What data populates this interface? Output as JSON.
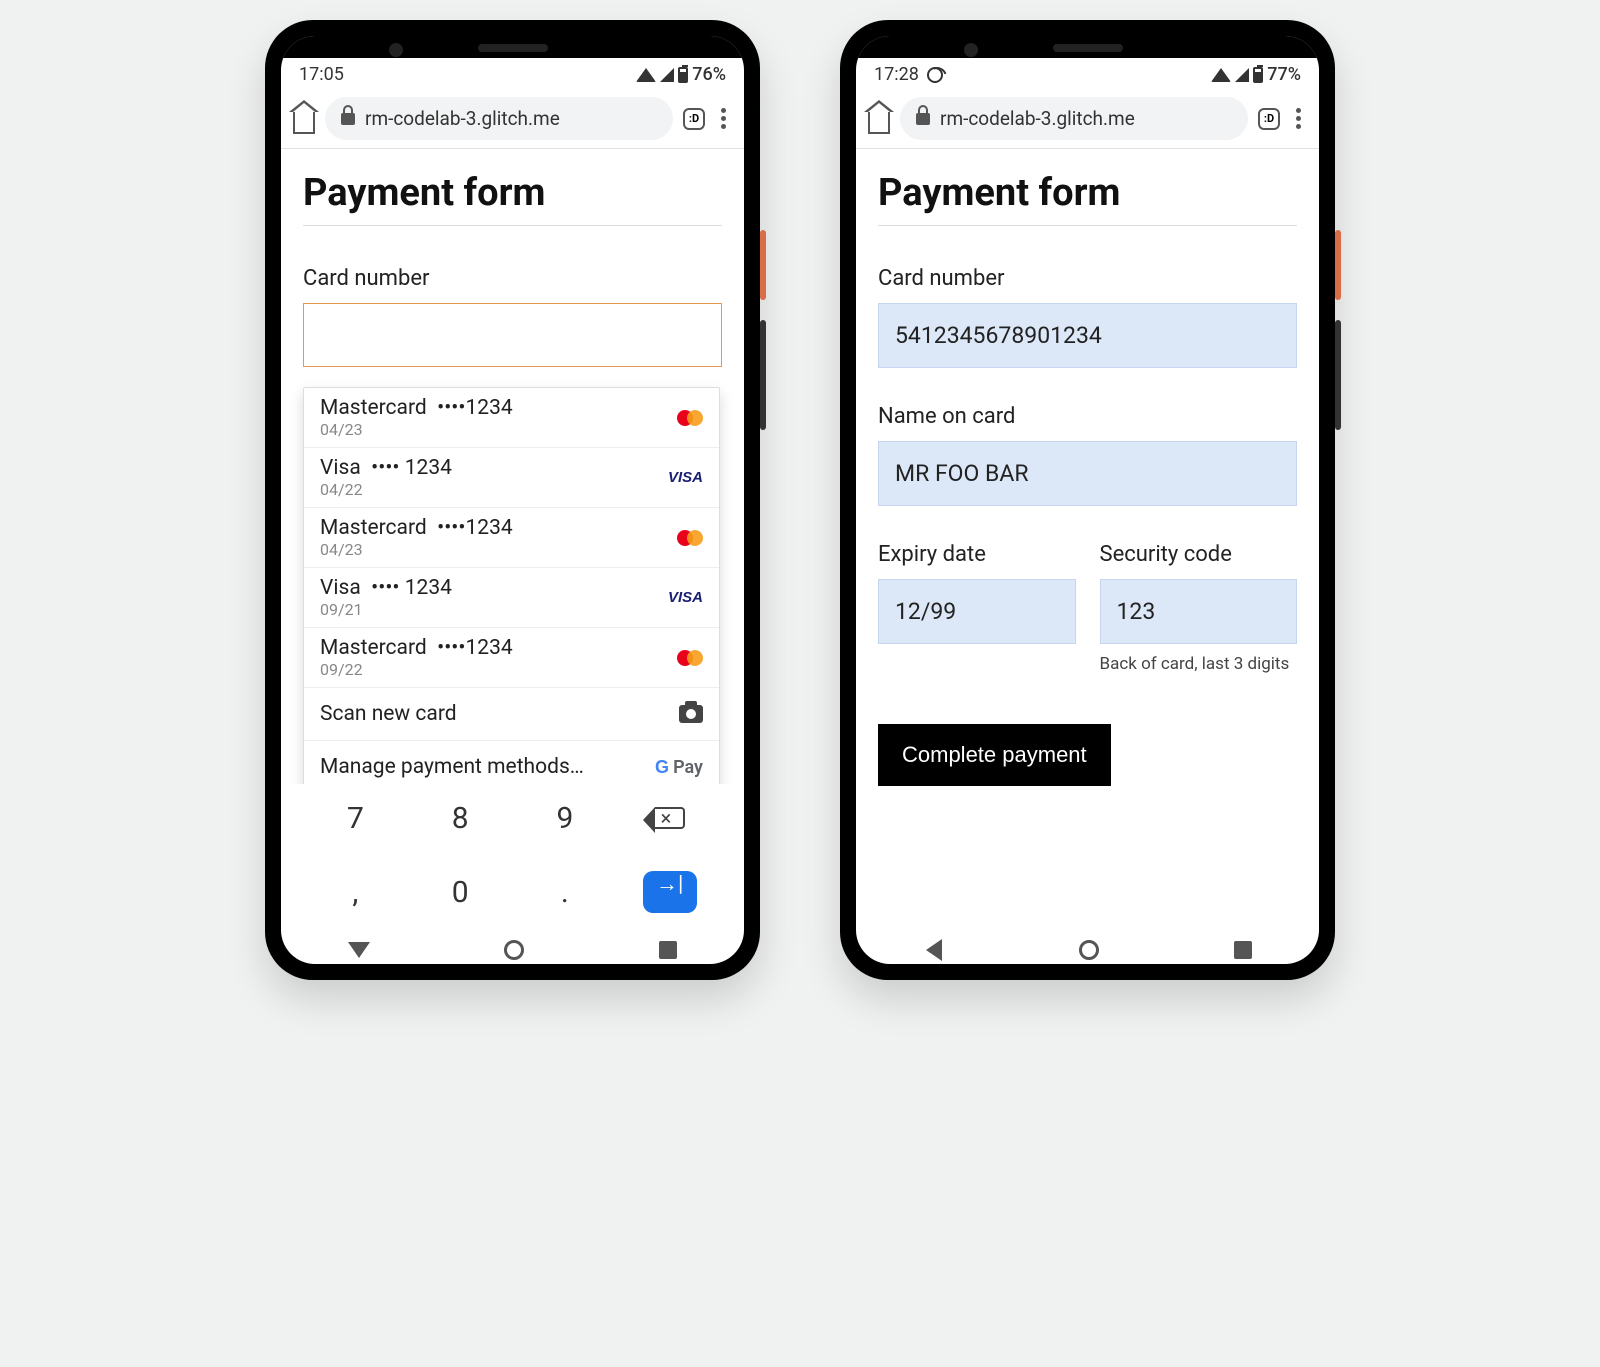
{
  "left": {
    "status": {
      "time": "17:05",
      "battery": "76%"
    },
    "chrome": {
      "url": "rm-codelab-3.glitch.me",
      "tabs": ":D"
    },
    "page_title": "Payment form",
    "card_number_label": "Card number",
    "autofill": [
      {
        "brand": "Mastercard",
        "mask": "••••1234",
        "exp": "04/23",
        "type": "mc"
      },
      {
        "brand": "Visa",
        "mask": "•••• 1234",
        "exp": "04/22",
        "type": "visa"
      },
      {
        "brand": "Mastercard",
        "mask": "••••1234",
        "exp": "04/23",
        "type": "mc"
      },
      {
        "brand": "Visa",
        "mask": "•••• 1234",
        "exp": "09/21",
        "type": "visa"
      },
      {
        "brand": "Mastercard",
        "mask": "••••1234",
        "exp": "09/22",
        "type": "mc"
      }
    ],
    "scan_label": "Scan new card",
    "manage_label": "Manage payment methods…",
    "gpay_label": "Pay",
    "keypad": {
      "k7": "7",
      "k8": "8",
      "k9": "9",
      "kc": ",",
      "k0": "0",
      "kd": "."
    }
  },
  "right": {
    "status": {
      "time": "17:28",
      "battery": "77%"
    },
    "chrome": {
      "url": "rm-codelab-3.glitch.me",
      "tabs": ":D"
    },
    "page_title": "Payment form",
    "card_number_label": "Card number",
    "card_number_value": "5412345678901234",
    "name_label": "Name on card",
    "name_value": "MR FOO BAR",
    "expiry_label": "Expiry date",
    "expiry_value": "12/99",
    "cvc_label": "Security code",
    "cvc_value": "123",
    "cvc_help": "Back of card, last 3 digits",
    "submit_label": "Complete payment"
  }
}
